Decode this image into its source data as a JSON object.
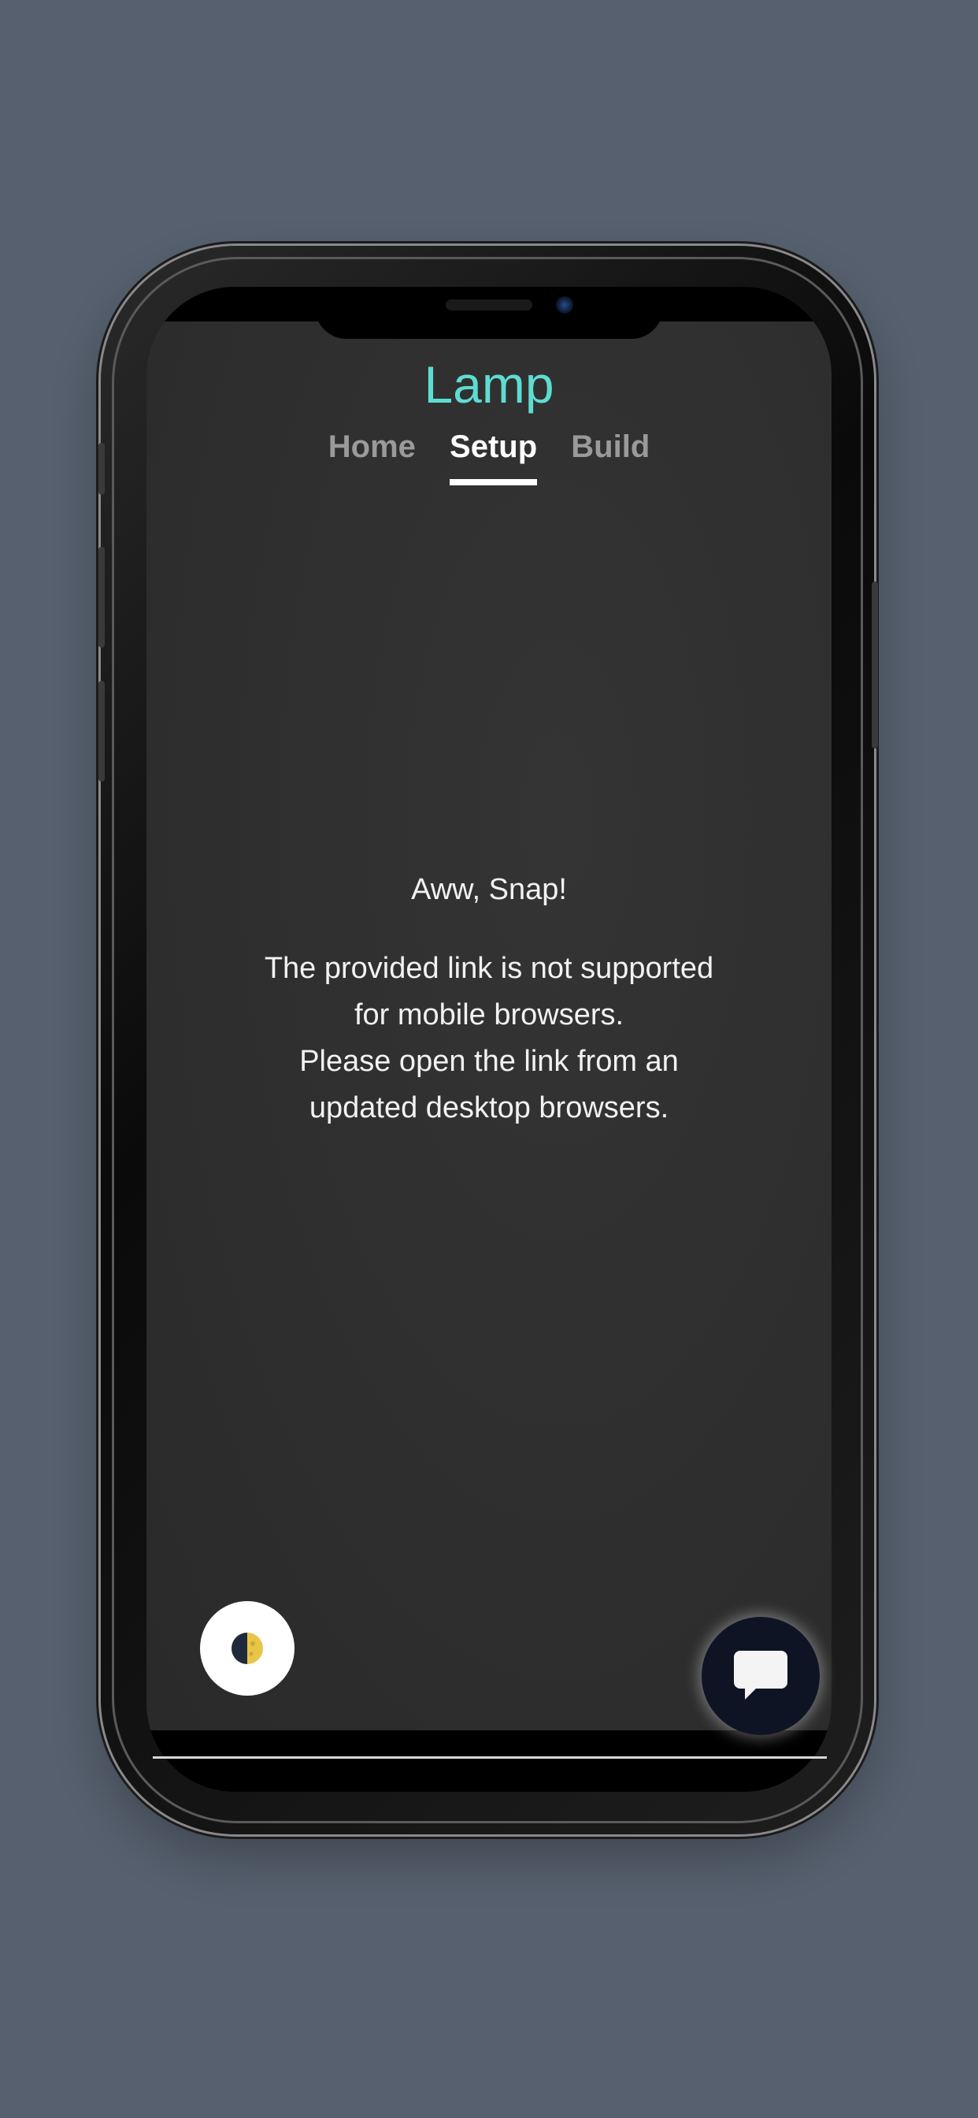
{
  "app": {
    "title": "Lamp"
  },
  "nav": {
    "tabs": [
      {
        "label": "Home",
        "active": false
      },
      {
        "label": "Setup",
        "active": true
      },
      {
        "label": "Build",
        "active": false
      }
    ]
  },
  "message": {
    "title": "Aww, Snap!",
    "line1": "The provided link is not supported",
    "line2": "for mobile browsers.",
    "line3": "Please open the link from an",
    "line4": "updated desktop browsers."
  },
  "icons": {
    "theme_toggle": "half-moon-icon",
    "chat": "chat-bubble-icon"
  },
  "colors": {
    "accent": "#5fdcd1",
    "background": "#56606e",
    "screen": "#2f2f2f"
  }
}
